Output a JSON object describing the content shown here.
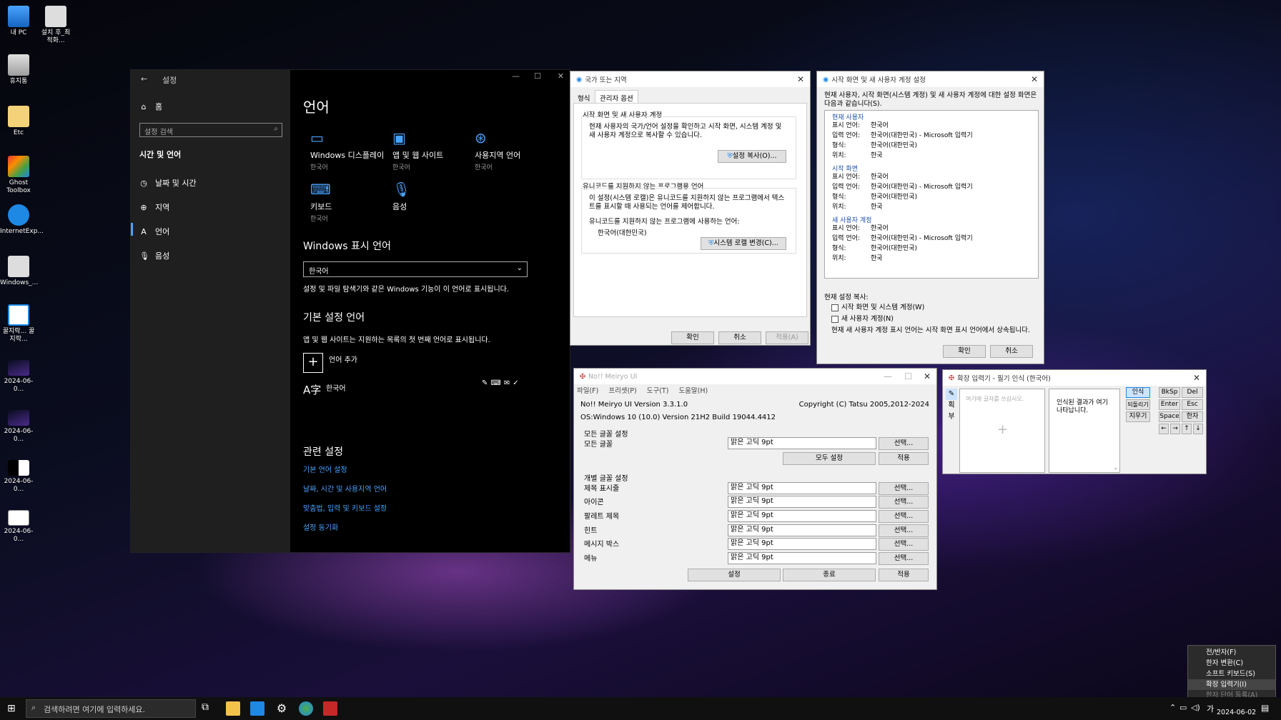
{
  "desktop": {
    "icons": [
      {
        "label": "내 PC"
      },
      {
        "label": "설치 후_최적화..."
      },
      {
        "label": "휴지통"
      },
      {
        "label": "Etc"
      },
      {
        "label": "Ghost Toolbox"
      },
      {
        "label": "InternetExp..."
      },
      {
        "label": "Windows_..."
      },
      {
        "label": "꿀지락... 꿀지락..."
      },
      {
        "label": "2024-06-0..."
      },
      {
        "label": "2024-06-0..."
      },
      {
        "label": "2024-06-0..."
      },
      {
        "label": "2024-06-0..."
      }
    ]
  },
  "settings": {
    "title": "설정",
    "nav_home": "홈",
    "search_placeholder": "설정 검색",
    "section": "시간 및 언어",
    "nav": [
      {
        "label": "날짜 및 시간"
      },
      {
        "label": "지역"
      },
      {
        "label": "언어"
      },
      {
        "label": "음성"
      }
    ],
    "page_title": "언어",
    "tiles": [
      {
        "label": "Windows 디스플레이",
        "sub": "한국어"
      },
      {
        "label": "앱 및 웹 사이트",
        "sub": "한국어"
      },
      {
        "label": "사용지역 언어",
        "sub": "한국어"
      },
      {
        "label": "키보드",
        "sub": "한국어"
      },
      {
        "label": "음성",
        "sub": ""
      }
    ],
    "display_lang_heading": "Windows 표시 언어",
    "display_lang_value": "한국어",
    "display_lang_desc": "설정 및 파일 탐색기와 같은 Windows 기능이 이 언어로 표시됩니다.",
    "pref_heading": "기본 설정 언어",
    "pref_desc": "앱 및 웹 사이트는 지원하는 목록의 첫 번째 언어로 표시됩니다.",
    "add_lang": "언어 추가",
    "lang_item": "한국어",
    "related_heading": "관련 설정",
    "related_links": [
      {
        "label": "기본 언어 설정"
      },
      {
        "label": "날짜, 시간 및 사용지역 언어"
      },
      {
        "label": "맞춤법, 입력 및 키보드 설정"
      },
      {
        "label": "설정 동기화"
      }
    ]
  },
  "region": {
    "title": "국가 또는 지역",
    "tabs": [
      "형식",
      "관리자 옵션"
    ],
    "g1_title": "시작 화면 및 새 사용자 계정",
    "g1_text": "현재 사용자의 국가/언어 설정을 확인하고 시작 화면, 시스템 계정 및 새 사용자 계정으로 복사할 수 있습니다.",
    "copy_btn": "설정 복사(O)...",
    "g2_title": "유니코드를 지원하지 않는 프로그램용 언어",
    "g2_text": "이 설정(시스템 로캘)은 유니코드를 지원하지 않는 프로그램에서 텍스트를 표시할 때 사용되는 언어를 제어합니다.",
    "g2_label": "유니코드를 지원하지 않는 프로그램에 사용하는 언어:",
    "g2_value": "한국어(대한민국)",
    "locale_btn": "시스템 로캘 변경(C)...",
    "ok": "확인",
    "cancel": "취소",
    "apply": "적용(A)"
  },
  "welcome": {
    "title": "시작 화면 및 새 사용자 계정 설정",
    "intro": "현재 사용자, 시작 화면(시스템 계정) 및 새 사용자 계정에 대한 설정 화면은 다음과 같습니다(S).",
    "sections": [
      {
        "heading": "현재 사용자",
        "rows": [
          [
            "표시 언어:",
            "한국어"
          ],
          [
            "입력 언어:",
            "한국어(대한민국) - Microsoft 입력기"
          ],
          [
            "형식:",
            "한국어(대한민국)"
          ],
          [
            "위치:",
            "한국"
          ]
        ]
      },
      {
        "heading": "시작 화면",
        "rows": [
          [
            "표시 언어:",
            "한국어"
          ],
          [
            "입력 언어:",
            "한국어(대한민국) - Microsoft 입력기"
          ],
          [
            "형식:",
            "한국어(대한민국)"
          ],
          [
            "위치:",
            "한국"
          ]
        ]
      },
      {
        "heading": "새 사용자 계정",
        "rows": [
          [
            "표시 언어:",
            "한국어"
          ],
          [
            "입력 언어:",
            "한국어(대한민국) - Microsoft 입력기"
          ],
          [
            "형식:",
            "한국어(대한민국)"
          ],
          [
            "위치:",
            "한국"
          ]
        ]
      }
    ],
    "copy_heading": "현재 설정 복사:",
    "chk1": "시작 화면 및 시스템 계정(W)",
    "chk2": "새 사용자 계정(N)",
    "note": "현재 새 사용자 계정 표시 언어는 시작 화면 표시 언어에서 상속됩니다.",
    "ok": "확인",
    "cancel": "취소"
  },
  "meiryo": {
    "title": "No!! Meiryo UI",
    "menu": [
      "파일(F)",
      "프리셋(P)",
      "도구(T)",
      "도움말(H)"
    ],
    "version": "No!! Meiryo UI Version 3.3.1.0",
    "copyright": "Copyright (C) Tatsu 2005,2012-2024",
    "os": "OS:Windows 10 (10.0) Version 21H2 Build 19044.4412",
    "all_group": "모든 글꼴 설정",
    "all_label": "모든 글꼴",
    "font_value": "맑은 고딕   9pt",
    "select": "선택...",
    "all_set": "모두 설정",
    "apply": "적용",
    "individual_group": "개별 글꼴 설정",
    "items": [
      {
        "label": "제목 표시줄"
      },
      {
        "label": "아이콘"
      },
      {
        "label": "팔레트 제목"
      },
      {
        "label": "힌트"
      },
      {
        "label": "메시지 박스"
      },
      {
        "label": "메뉴"
      }
    ],
    "set": "설정",
    "exit": "종료"
  },
  "handwriting": {
    "title": "확장 입력기 - 필기 인식 (한국어)",
    "placeholder": "여기에 글자를 쓰십시오.",
    "result": "인식된 결과가 여기 나타납니다.",
    "side_tabs": [
      "✎",
      "획",
      "부"
    ],
    "btn_recognize": "인식",
    "btn_undo": "되돌리기",
    "btn_clear": "지우기",
    "keys": [
      "BkSp",
      "Del",
      "Enter",
      "Esc",
      "Space",
      "한자"
    ],
    "arrows": [
      "←",
      "→",
      "↑",
      "↓"
    ]
  },
  "context_menu": {
    "items": [
      {
        "label": "전/반자(F)"
      },
      {
        "label": "한자 변환(C)"
      },
      {
        "label": "소프트 키보드(S)"
      },
      {
        "label": "확장 입력기(I)"
      },
      {
        "label": "한자 단어 등록(A)"
      }
    ]
  },
  "taskbar": {
    "search_placeholder": "검색하려면 여기에 입력하세요.",
    "ime": "가",
    "date": "2024-06-02"
  },
  "colors": {
    "accent": "#4aa3ff",
    "taskbar": "#101010",
    "settings_side": "#1f1f1f"
  }
}
